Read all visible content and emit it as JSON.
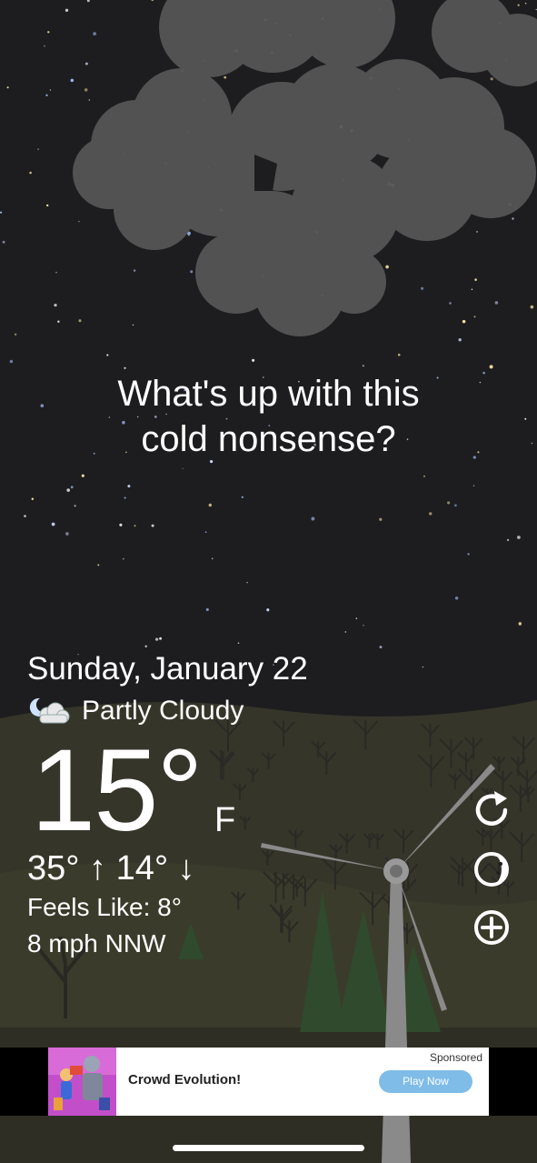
{
  "colors": {
    "sky": "#1d1d1f",
    "cloud": "#505050",
    "ground": "#3a3a2c",
    "tree": "#2c2a26",
    "pine": "#2f4a2c",
    "turbine": "#8a8a8a",
    "text": "#ffffff",
    "ad_button": "#7fbce8"
  },
  "quote": {
    "line1": "What's up with this",
    "line2": "cold nonsense?"
  },
  "weather": {
    "date": "Sunday, January 22",
    "condition": "Partly Cloudy",
    "condition_icon": "partly-cloudy-night-icon",
    "temperature": "15°",
    "unit": "F",
    "high_low": "35° ↑  14° ↓",
    "feels_like": "Feels Like: 8°",
    "wind": "8 mph NNW"
  },
  "actions": [
    {
      "icon": "refresh-icon"
    },
    {
      "icon": "moon-phase-icon"
    },
    {
      "icon": "add-location-icon"
    }
  ],
  "ad": {
    "sponsored": "Sponsored",
    "title": "Crowd Evolution!",
    "button": "Play Now"
  }
}
